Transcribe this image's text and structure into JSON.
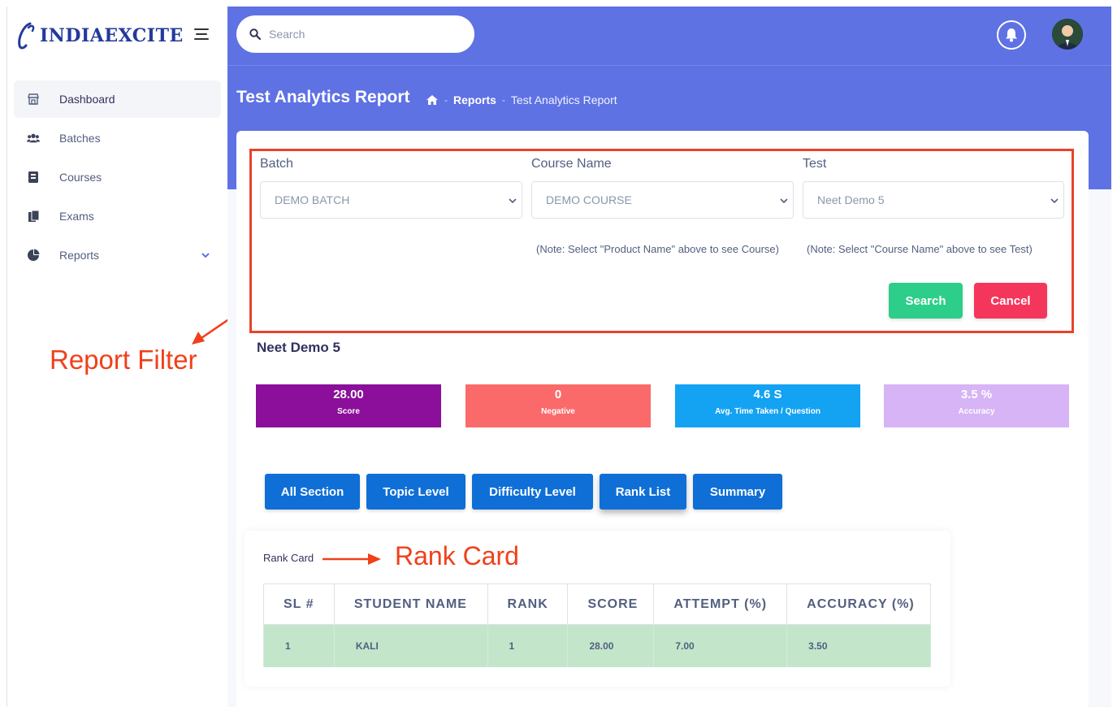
{
  "brand": {
    "name": "INDIAEXCITE",
    "color": "#233a9c"
  },
  "colors": {
    "header": "#5e72e4",
    "filter_border": "#e8432a",
    "annotation": "#f0401a"
  },
  "header": {
    "search_placeholder": "Search"
  },
  "sidebar": {
    "items": [
      {
        "label": "Dashboard",
        "icon": "store-icon",
        "active": true
      },
      {
        "label": "Batches",
        "icon": "users-icon"
      },
      {
        "label": "Courses",
        "icon": "book-icon"
      },
      {
        "label": "Exams",
        "icon": "copy-icon"
      },
      {
        "label": "Reports",
        "icon": "pie-chart-icon",
        "has_submenu": true
      }
    ]
  },
  "page": {
    "title": "Test Analytics Report",
    "breadcrumb": [
      "Reports",
      "Test Analytics Report"
    ]
  },
  "filter": {
    "batch_label": "Batch",
    "batch_value": "DEMO BATCH",
    "course_label": "Course Name",
    "course_value": "DEMO COURSE",
    "test_label": "Test",
    "test_value": "Neet Demo 5",
    "course_note": "(Note: Select \"Product Name\" above to see Course)",
    "test_note": "(Note: Select \"Course Name\" above to see Test)",
    "search_label": "Search",
    "cancel_label": "Cancel"
  },
  "annotations": {
    "report_filter": "Report Filter",
    "rank_card": "Rank Card"
  },
  "test_name": "Neet Demo 5",
  "stats": [
    {
      "value": "28.00",
      "label": "Score",
      "color": "#8b0f9a"
    },
    {
      "value": "0",
      "label": "Negative",
      "color": "#fb6a6a"
    },
    {
      "value": "4.6 S",
      "label": "Avg. Time Taken / Question",
      "color": "#13a3f2"
    },
    {
      "value": "3.5 %",
      "label": "Accuracy",
      "color": "#d6b4f6"
    }
  ],
  "tabs": [
    "All Section",
    "Topic Level",
    "Difficulty Level",
    "Rank List",
    "Summary"
  ],
  "rank_card": {
    "title": "Rank Card",
    "columns": [
      "SL #",
      "STUDENT NAME",
      "RANK",
      "SCORE",
      "ATTEMPT (%)",
      "ACCURACY (%)"
    ],
    "rows": [
      [
        "1",
        "KALI",
        "1",
        "28.00",
        "7.00",
        "3.50"
      ]
    ]
  }
}
